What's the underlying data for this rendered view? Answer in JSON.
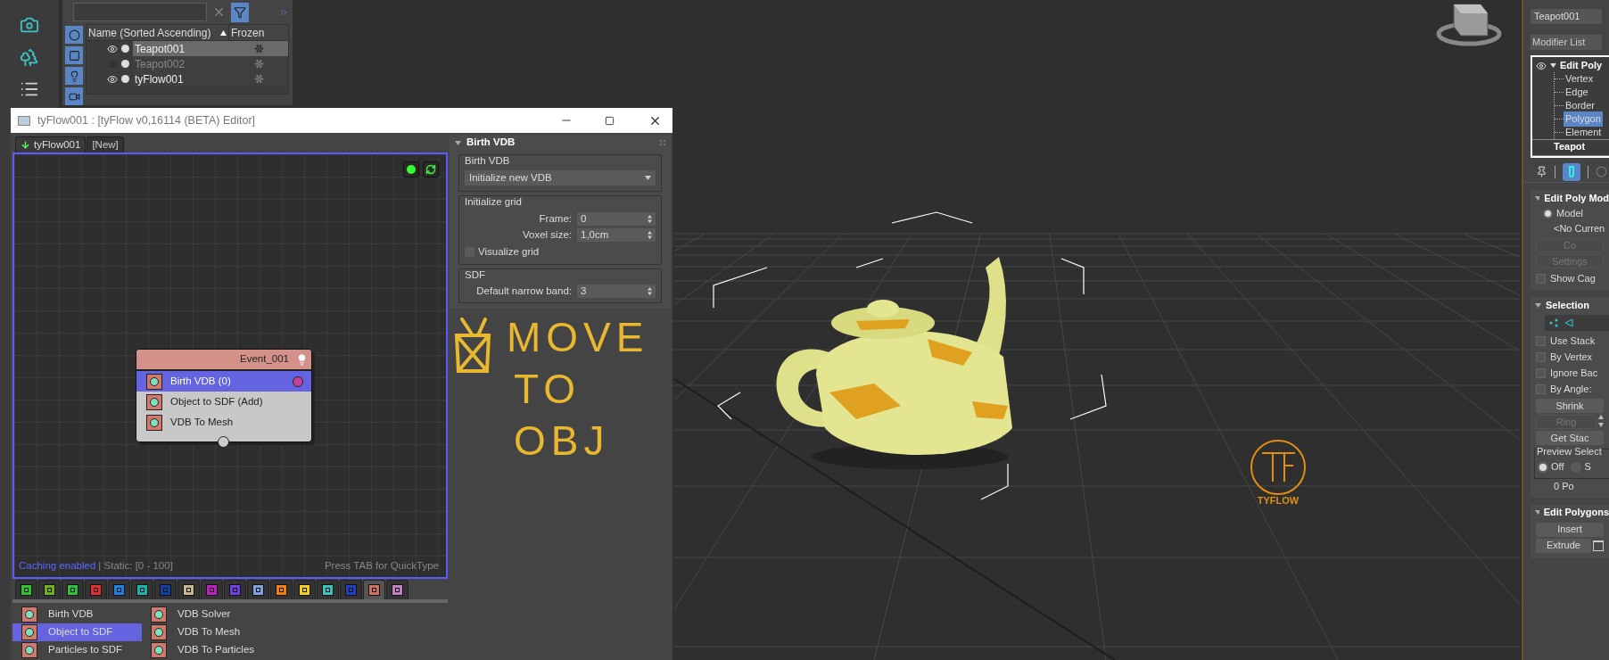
{
  "scene_explorer": {
    "columns": [
      "Name (Sorted Ascending)",
      "Frozen"
    ],
    "rows": [
      {
        "name": "Teapot001",
        "visible": true,
        "selected": true
      },
      {
        "name": "Teapot002",
        "visible": false,
        "selected": false
      },
      {
        "name": "tyFlow001",
        "visible": true,
        "selected": false
      }
    ]
  },
  "editor": {
    "title": "tyFlow001 : [tyFlow v0,16114 (BETA) Editor]",
    "tabs": [
      {
        "label": "tyFlow001",
        "selected": true
      },
      {
        "label": "[New]",
        "selected": false
      }
    ],
    "event": {
      "title": "Event_001",
      "operators": [
        {
          "label": "Birth VDB (0)",
          "selected": true,
          "output": true
        },
        {
          "label": "Object to SDF (Add)",
          "selected": false,
          "output": false
        },
        {
          "label": "VDB To Mesh",
          "selected": false,
          "output": false
        }
      ]
    },
    "status": {
      "caching": "Caching enabled",
      "range": "| Static: [0 - 100]",
      "hint": "Press TAB for QuickType"
    },
    "categories": [
      {
        "color": "#30c030",
        "selected": false
      },
      {
        "color": "#70b020",
        "selected": false
      },
      {
        "color": "#30c040",
        "selected": false
      },
      {
        "color": "#e03030",
        "selected": false
      },
      {
        "color": "#2080e0",
        "selected": false
      },
      {
        "color": "#20b0b0",
        "selected": false
      },
      {
        "color": "#1040a0",
        "selected": false
      },
      {
        "color": "#c8b890",
        "selected": false
      },
      {
        "color": "#c020c0",
        "selected": false
      },
      {
        "color": "#7040e0",
        "selected": false
      },
      {
        "color": "#80a0e0",
        "selected": false
      },
      {
        "color": "#f08010",
        "selected": false
      },
      {
        "color": "#f0d020",
        "selected": false
      },
      {
        "color": "#40c0c0",
        "selected": false
      },
      {
        "color": "#2040c0",
        "selected": false
      },
      {
        "color": "#d07060",
        "selected": true
      },
      {
        "color": "#c080c0",
        "selected": false
      }
    ],
    "operator_list": [
      {
        "label": "Birth VDB",
        "selected": false
      },
      {
        "label": "Object to SDF",
        "selected": true
      },
      {
        "label": "Particles to SDF",
        "selected": false
      },
      {
        "label": "VDB Solver",
        "selected": false
      },
      {
        "label": "VDB To Mesh",
        "selected": false
      },
      {
        "label": "VDB To Particles",
        "selected": false
      }
    ],
    "parameters": {
      "title": "Birth VDB",
      "groups": [
        {
          "title": "Birth VDB",
          "controls": [
            {
              "kind": "dropdown",
              "value": "Initialize new VDB"
            }
          ]
        },
        {
          "title": "Initialize grid",
          "controls": [
            {
              "kind": "spinner",
              "label": "Frame:",
              "value": "0"
            },
            {
              "kind": "spinner",
              "label": "Voxel size:",
              "value": "1,0cm"
            },
            {
              "kind": "checkbox",
              "label": "Visualize grid",
              "checked": false
            }
          ]
        },
        {
          "title": "SDF",
          "controls": [
            {
              "kind": "spinner",
              "label": "Default narrow band:",
              "value": "3"
            }
          ]
        }
      ]
    },
    "annotation": {
      "lines": [
        "MOVE",
        "TO",
        "OBJ"
      ]
    }
  },
  "viewport": {
    "logo": "TYFLOW"
  },
  "command_panel": {
    "object_name": "Teapot001",
    "modifier_list": "Modifier List",
    "stack": [
      {
        "label": "Edit Poly",
        "expanded": true,
        "children": [
          {
            "label": "Vertex",
            "selected": false
          },
          {
            "label": "Edge",
            "selected": false
          },
          {
            "label": "Border",
            "selected": false
          },
          {
            "label": "Polygon",
            "selected": true
          },
          {
            "label": "Element",
            "selected": false
          }
        ]
      },
      {
        "label": "Teapot",
        "expanded": false
      }
    ],
    "rollouts": [
      {
        "title": "Edit Poly Mod",
        "items": [
          {
            "kind": "radio",
            "label": "Model",
            "selected": true
          },
          {
            "kind": "text",
            "label": "<No Curren"
          },
          {
            "kind": "button",
            "label": "Co",
            "disabled": true
          },
          {
            "kind": "button",
            "label": "Settings",
            "disabled": true
          },
          {
            "kind": "checkbox",
            "label": "Show Cag",
            "checked": false
          }
        ]
      },
      {
        "title": "Selection",
        "items": [
          {
            "kind": "icons"
          },
          {
            "kind": "checkbox",
            "label": "Use Stack",
            "checked": false
          },
          {
            "kind": "checkbox",
            "label": "By Vertex",
            "checked": false
          },
          {
            "kind": "checkbox",
            "label": "Ignore Bac",
            "checked": false
          },
          {
            "kind": "checkbox",
            "label": "By Angle:",
            "checked": false
          },
          {
            "kind": "button",
            "label": "Shrink",
            "disabled": false
          },
          {
            "kind": "spinner_button",
            "label": "Ring",
            "disabled": true
          },
          {
            "kind": "button",
            "label": "Get Stac",
            "disabled": false
          },
          {
            "kind": "radio_group",
            "title": "Preview Select",
            "options": [
              {
                "label": "Off",
                "selected": true
              },
              {
                "label": "S",
                "selected": false
              }
            ]
          },
          {
            "kind": "text",
            "label": "0 Po"
          }
        ]
      },
      {
        "title": "Edit Polygons",
        "items": [
          {
            "kind": "button",
            "label": "Insert",
            "disabled": false
          },
          {
            "kind": "settings_button",
            "label": "Extrude",
            "disabled": false
          }
        ]
      }
    ]
  }
}
